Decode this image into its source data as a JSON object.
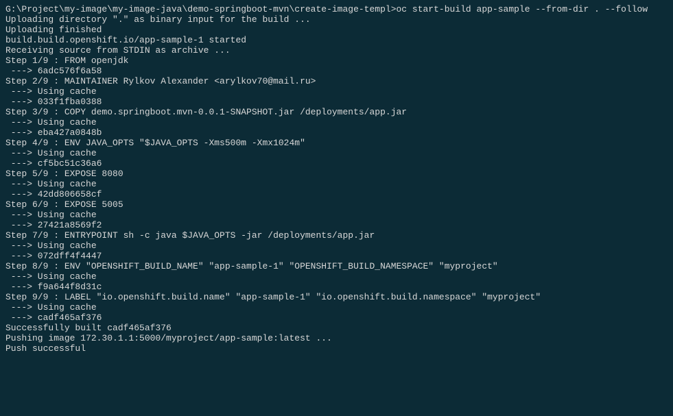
{
  "prompt": "G:\\Project\\my-image\\my-image-java\\demo-springboot-mvn\\create-image-templ>",
  "command": "oc start-build app-sample --from-dir . --follow",
  "lines": [
    "Uploading directory \".\" as binary input for the build ...",
    "",
    "Uploading finished",
    "build.build.openshift.io/app-sample-1 started",
    "Receiving source from STDIN as archive ...",
    "Step 1/9 : FROM openjdk",
    " ---> 6adc576f6a58",
    "Step 2/9 : MAINTAINER Rylkov Alexander <arylkov70@mail.ru>",
    " ---> Using cache",
    " ---> 033f1fba0388",
    "Step 3/9 : COPY demo.springboot.mvn-0.0.1-SNAPSHOT.jar /deployments/app.jar",
    " ---> Using cache",
    " ---> eba427a0848b",
    "Step 4/9 : ENV JAVA_OPTS \"$JAVA_OPTS -Xms500m -Xmx1024m\"",
    " ---> Using cache",
    " ---> cf5bc51c36a6",
    "Step 5/9 : EXPOSE 8080",
    " ---> Using cache",
    " ---> 42dd806658cf",
    "Step 6/9 : EXPOSE 5005",
    " ---> Using cache",
    " ---> 27421a8569f2",
    "Step 7/9 : ENTRYPOINT sh -c java $JAVA_OPTS -jar /deployments/app.jar",
    " ---> Using cache",
    " ---> 072dff4f4447",
    "Step 8/9 : ENV \"OPENSHIFT_BUILD_NAME\" \"app-sample-1\" \"OPENSHIFT_BUILD_NAMESPACE\" \"myproject\"",
    " ---> Using cache",
    " ---> f9a644f8d31c",
    "Step 9/9 : LABEL \"io.openshift.build.name\" \"app-sample-1\" \"io.openshift.build.namespace\" \"myproject\"",
    " ---> Using cache",
    " ---> cadf465af376",
    "Successfully built cadf465af376",
    "Pushing image 172.30.1.1:5000/myproject/app-sample:latest ...",
    "Push successful"
  ]
}
